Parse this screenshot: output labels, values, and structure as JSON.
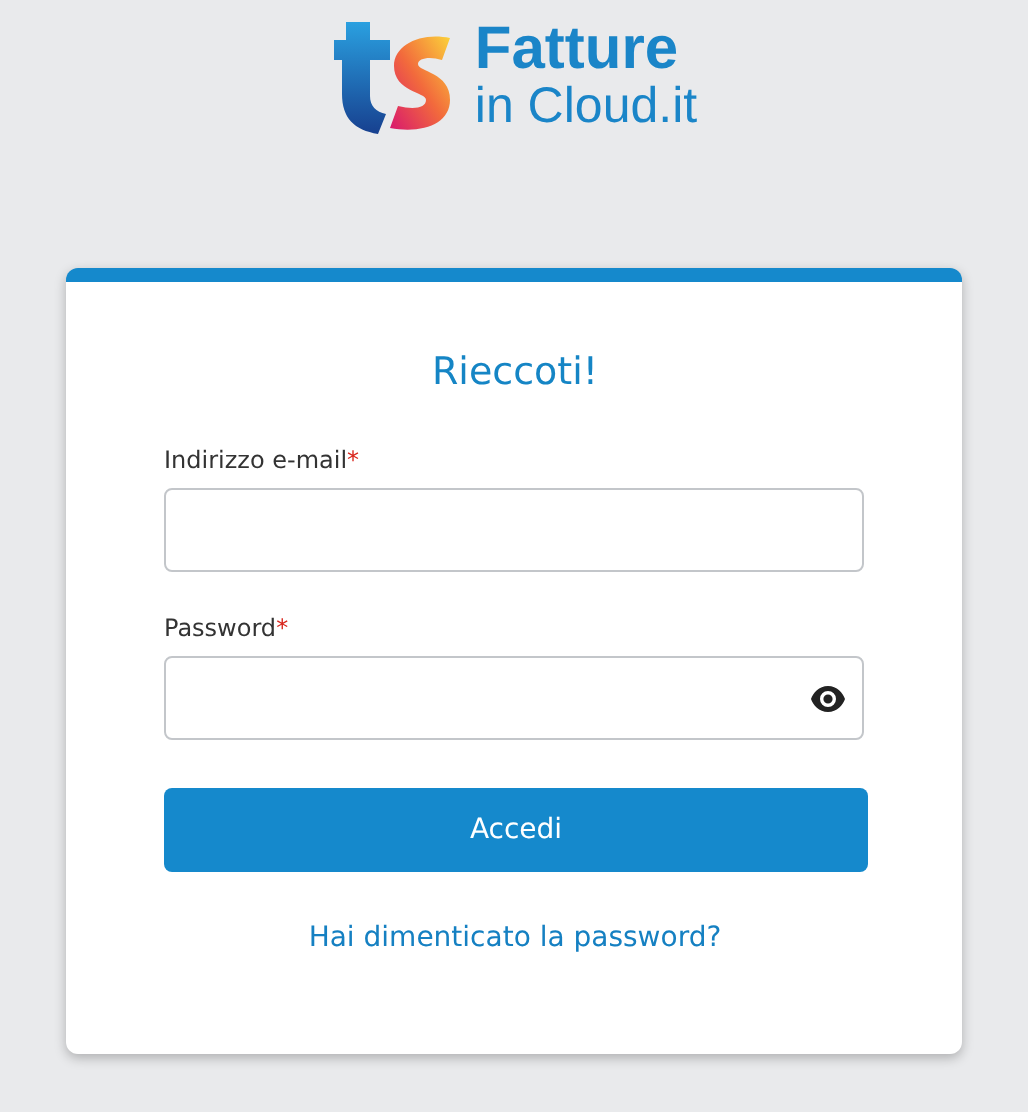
{
  "logo": {
    "line_1": "Fatture",
    "line_2": "in Cloud.it"
  },
  "card": {
    "title": "Rieccoti!",
    "fields": [
      {
        "kind": "text",
        "label": "Indirizzo e-mail",
        "required_mark": "*"
      },
      {
        "kind": "password",
        "label": "Password",
        "required_mark": "*"
      }
    ],
    "submit": "Accedi",
    "link": "Hai dimenticato la password?"
  }
}
